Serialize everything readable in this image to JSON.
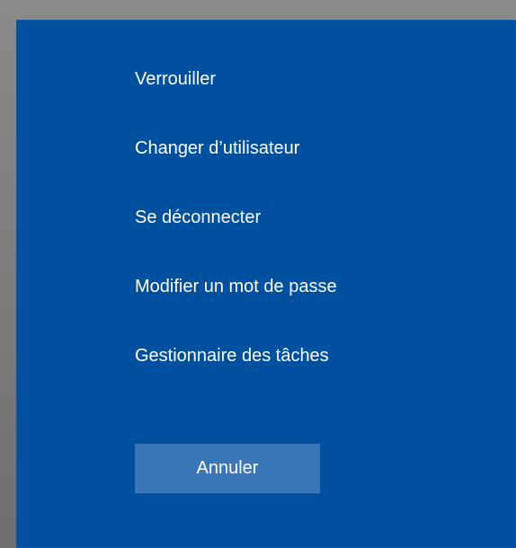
{
  "security_menu": {
    "items": [
      {
        "label": "Verrouiller"
      },
      {
        "label": "Changer d’utilisateur"
      },
      {
        "label": "Se déconnecter"
      },
      {
        "label": "Modifier un mot de passe"
      },
      {
        "label": "Gestionnaire des tâches"
      }
    ],
    "cancel_label": "Annuler"
  },
  "colors": {
    "panel_background": "#0050a0",
    "button_background": "#3a76b7",
    "text": "#ffffff"
  }
}
